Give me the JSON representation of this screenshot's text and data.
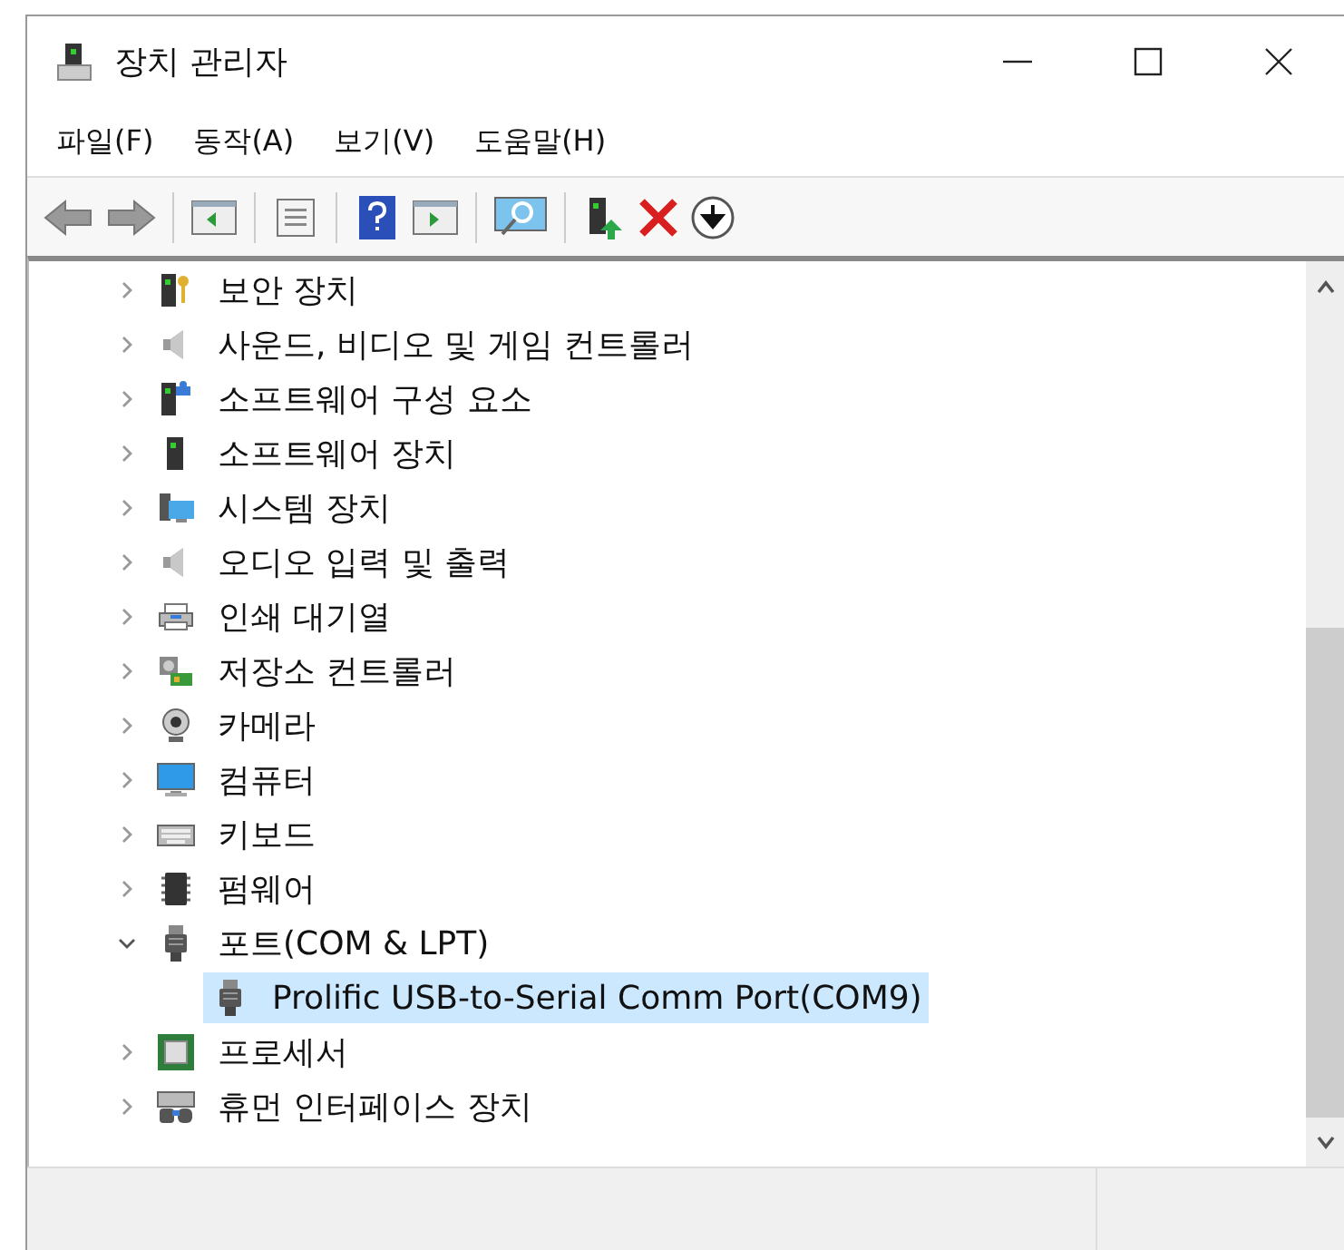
{
  "window": {
    "title": "장치 관리자"
  },
  "menu": [
    {
      "label": "파일(F)"
    },
    {
      "label": "동작(A)"
    },
    {
      "label": "보기(V)"
    },
    {
      "label": "도움말(H)"
    }
  ],
  "tree": [
    {
      "label": "보안 장치",
      "kind": "security",
      "expanded": false,
      "selected": false
    },
    {
      "label": "사운드, 비디오 및 게임 컨트롤러",
      "kind": "speaker",
      "expanded": false,
      "selected": false
    },
    {
      "label": "소프트웨어 구성 요소",
      "kind": "component",
      "expanded": false,
      "selected": false
    },
    {
      "label": "소프트웨어 장치",
      "kind": "tower",
      "expanded": false,
      "selected": false
    },
    {
      "label": "시스템 장치",
      "kind": "system",
      "expanded": false,
      "selected": false
    },
    {
      "label": "오디오 입력 및 출력",
      "kind": "speaker",
      "expanded": false,
      "selected": false
    },
    {
      "label": "인쇄 대기열",
      "kind": "printer",
      "expanded": false,
      "selected": false
    },
    {
      "label": "저장소 컨트롤러",
      "kind": "storage",
      "expanded": false,
      "selected": false
    },
    {
      "label": "카메라",
      "kind": "camera",
      "expanded": false,
      "selected": false
    },
    {
      "label": "컴퓨터",
      "kind": "monitor",
      "expanded": false,
      "selected": false
    },
    {
      "label": "키보드",
      "kind": "keyboard",
      "expanded": false,
      "selected": false
    },
    {
      "label": "펌웨어",
      "kind": "chip",
      "expanded": false,
      "selected": false
    },
    {
      "label": "포트(COM & LPT)",
      "kind": "port",
      "expanded": true,
      "selected": false,
      "children": [
        {
          "label": "Prolific USB-to-Serial Comm Port(COM9)",
          "kind": "port",
          "selected": true
        }
      ]
    },
    {
      "label": "프로세서",
      "kind": "cpu",
      "expanded": false,
      "selected": false
    },
    {
      "label": "휴먼 인터페이스 장치",
      "kind": "hid",
      "expanded": false,
      "selected": false
    }
  ]
}
